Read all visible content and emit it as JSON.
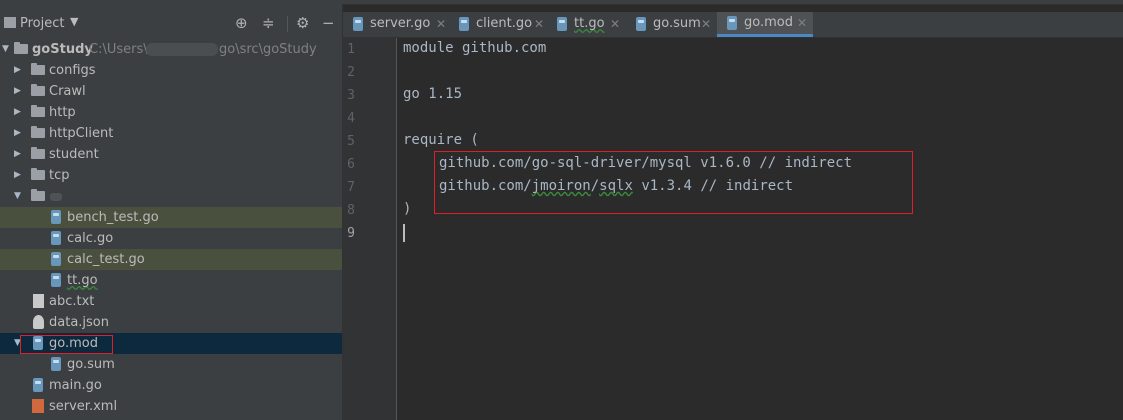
{
  "project_panel": {
    "title": "Project",
    "root": {
      "name": "goStudy",
      "path": "C:\\Users\\",
      "path_tail": "go\\src\\goStudy"
    },
    "folders": [
      "configs",
      "Crawl",
      "http",
      "httpClient",
      "student",
      "tcp"
    ],
    "subfolder_files": [
      "bench_test.go",
      "calc.go",
      "calc_test.go",
      "tt.go"
    ],
    "root_files": [
      "abc.txt",
      "data.json"
    ],
    "gomod": {
      "name": "go.mod",
      "child": "go.sum"
    },
    "more_files": [
      "main.go",
      "server.xml"
    ]
  },
  "tabs": [
    {
      "label": "server.go"
    },
    {
      "label": "client.go"
    },
    {
      "label": "tt.go"
    },
    {
      "label": "go.sum"
    },
    {
      "label": "go.mod"
    }
  ],
  "editor": {
    "line_numbers": [
      "1",
      "2",
      "3",
      "4",
      "5",
      "6",
      "7",
      "8",
      "9"
    ],
    "line1": "module github.com",
    "line3": "go 1.15",
    "line5": "require (",
    "line6": "github.com/go-sql-driver/mysql v1.6.0 // indirect",
    "line7_a": "github.com/",
    "line7_b": "jmoiron",
    "line7_c": "/",
    "line7_d": "sqlx",
    "line7_e": " v1.3.4 // indirect",
    "line8": ")"
  },
  "colors": {
    "highlight": "#e01f28",
    "selection": "#0d293e",
    "accent": "#4a88c7"
  }
}
